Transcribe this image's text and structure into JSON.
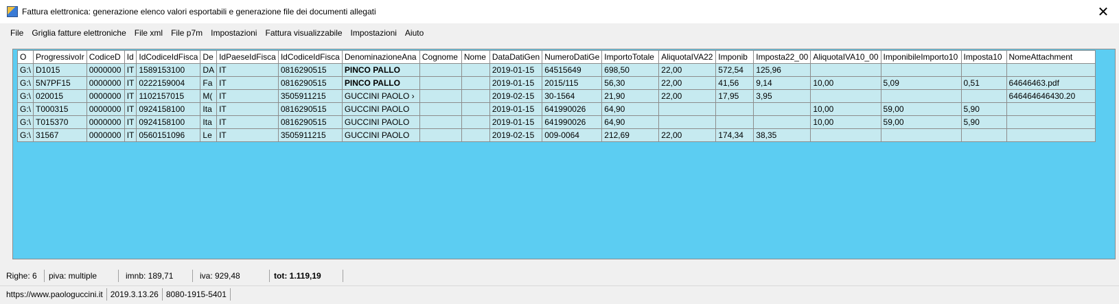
{
  "window": {
    "title": "Fattura elettronica: generazione elenco valori esportabili e generazione file dei documenti allegati",
    "close_glyph": "✕"
  },
  "menu": [
    "File",
    "Griglia fatture elettroniche",
    "File xml",
    "File p7m",
    "Impostazioni",
    "Fattura visualizzabile",
    "Impostazioni",
    "Aiuto"
  ],
  "grid": {
    "columns": [
      "O",
      "ProgressivoIr",
      "CodiceD",
      "Id",
      "IdCodiceIdFisca",
      "De",
      "IdPaeseIdFisca",
      "IdCodiceIdFisca",
      "DenominazioneAna",
      "Cognome",
      "Nome",
      "DataDatiGen",
      "NumeroDatiGe",
      "ImportoTotale",
      "AliquotaIVA22",
      "Imponib",
      "Imposta22_00",
      "AliquotaIVA10_00",
      "ImponibileImporto10",
      "Imposta10",
      "NomeAttachment"
    ],
    "rows": [
      [
        "G:\\",
        "D1015",
        "0000000",
        "IT",
        "1589153100",
        "DA",
        "IT",
        "0816290515",
        "PINCO PALLO",
        "",
        "",
        "2019-01-15",
        "64515649",
        "698,50",
        "22,00",
        "572,54",
        "125,96",
        "",
        "",
        "",
        ""
      ],
      [
        "G:\\",
        "5N7PF15",
        "0000000",
        "IT",
        "0222159004",
        "Fa",
        "IT",
        "0816290515",
        "PINCO PALLO",
        "",
        "",
        "2019-01-15",
        "2015/115",
        "56,30",
        "22,00",
        "41,56",
        "9,14",
        "10,00",
        "5,09",
        "0,51",
        "64646463.pdf"
      ],
      [
        "G:\\",
        "020015",
        "0000000",
        "IT",
        "1102157015",
        "M(",
        "IT",
        "3505911215",
        "GUCCINI PAOLO ›",
        "",
        "",
        "2019-02-15",
        "30-1564",
        "21,90",
        "22,00",
        "17,95",
        "3,95",
        "",
        "",
        "",
        "646464646430.20"
      ],
      [
        "G:\\",
        "T000315",
        "0000000",
        "IT",
        "0924158100",
        "Ita",
        "IT",
        "0816290515",
        "GUCCINI PAOLO",
        "",
        "",
        "2019-01-15",
        "641990026",
        "64,90",
        "",
        "",
        "",
        "10,00",
        "59,00",
        "5,90",
        ""
      ],
      [
        "G:\\",
        "T015370",
        "0000000",
        "IT",
        "0924158100",
        "Ita",
        "IT",
        "0816290515",
        "GUCCINI PAOLO",
        "",
        "",
        "2019-01-15",
        "641990026",
        "64,90",
        "",
        "",
        "",
        "10,00",
        "59,00",
        "5,90",
        ""
      ],
      [
        "G:\\",
        "31567",
        "0000000",
        "IT",
        "0560151096",
        "Le",
        "IT",
        "3505911215",
        "GUCCINI PAOLO",
        "",
        "",
        "2019-02-15",
        "009-0064",
        "212,69",
        "22,00",
        "174,34",
        "38,35",
        "",
        "",
        "",
        ""
      ]
    ]
  },
  "status": {
    "righe": "Righe: 6",
    "piva": "piva: multiple",
    "imnb": "imnb: 189,71",
    "iva": "iva: 929,48",
    "tot": "tot: 1.119,19"
  },
  "footer": {
    "url": "https://www.paologuccini.it",
    "version": "2019.3.13.26",
    "code": "8080-1915-5401"
  }
}
